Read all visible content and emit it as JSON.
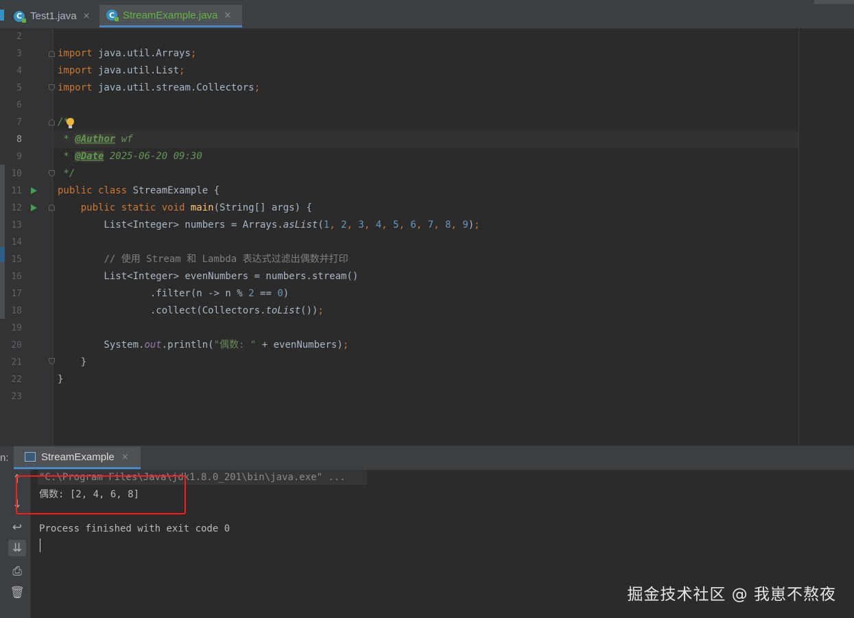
{
  "tabs": [
    {
      "label": "Test1.java",
      "close": "×",
      "color": "#a9b7c6",
      "active": false
    },
    {
      "label": "StreamExample.java",
      "close": "×",
      "color": "#62b543",
      "active": true
    }
  ],
  "editor": {
    "current_line": 8,
    "lines": [
      {
        "n": "2",
        "html": ""
      },
      {
        "n": "3",
        "html": "<span class=\"kw\">import</span> java.util.Arrays<span class=\"kw\">;</span>"
      },
      {
        "n": "4",
        "html": "<span class=\"kw\">import</span> java.util.List<span class=\"kw\">;</span>"
      },
      {
        "n": "5",
        "html": "<span class=\"kw\">import</span> java.util.stream.Collectors<span class=\"kw\">;</span>"
      },
      {
        "n": "6",
        "html": ""
      },
      {
        "n": "7",
        "html": "<span class=\"doc\">/**</span>"
      },
      {
        "n": "8",
        "html": "<span class=\"doc\"> * </span><span class=\"tag\">@Author</span><span class=\"doc\"> wf</span>"
      },
      {
        "n": "9",
        "html": "<span class=\"doc\"> * </span><span class=\"tag\">@Date</span><span class=\"doc\"> 2025-06-20 09:30</span>"
      },
      {
        "n": "10",
        "html": "<span class=\"doc\"> */</span>"
      },
      {
        "n": "11",
        "html": "<span class=\"kw\">public class</span> StreamExample {"
      },
      {
        "n": "12",
        "html": "    <span class=\"kw\">public static void</span> <span class=\"fn\">main</span>(String[] args) {"
      },
      {
        "n": "13",
        "html": "        List&lt;Integer&gt; numbers = Arrays.<span class=\"it\">asList</span>(<span class=\"num\">1</span><span class=\"kw\">,</span> <span class=\"num\">2</span><span class=\"kw\">,</span> <span class=\"num\">3</span><span class=\"kw\">,</span> <span class=\"num\">4</span><span class=\"kw\">,</span> <span class=\"num\">5</span><span class=\"kw\">,</span> <span class=\"num\">6</span><span class=\"kw\">,</span> <span class=\"num\">7</span><span class=\"kw\">,</span> <span class=\"num\">8</span><span class=\"kw\">,</span> <span class=\"num\">9</span>)<span class=\"kw\">;</span>"
      },
      {
        "n": "14",
        "html": ""
      },
      {
        "n": "15",
        "html": "        <span class=\"cm\">// 使用 Stream 和 Lambda 表达式过滤出偶数并打印</span>"
      },
      {
        "n": "16",
        "html": "        List&lt;Integer&gt; evenNumbers = numbers.stream()"
      },
      {
        "n": "17",
        "html": "                .filter(n -&gt; n % <span class=\"num\">2</span> == <span class=\"num\">0</span>)"
      },
      {
        "n": "18",
        "html": "                .collect(Collectors.<span class=\"it\">toList</span>())<span class=\"kw\">;</span>"
      },
      {
        "n": "19",
        "html": ""
      },
      {
        "n": "20",
        "html": "        System.<span class=\"fld\">out</span>.println(<span class=\"str\">\"偶数: \"</span> + evenNumbers)<span class=\"kw\">;</span>"
      },
      {
        "n": "21",
        "html": "    }"
      },
      {
        "n": "22",
        "html": "}"
      },
      {
        "n": "23",
        "html": ""
      }
    ]
  },
  "run_panel": {
    "label": "n:",
    "tab_label": "StreamExample",
    "tab_close": "×",
    "console_lines": [
      "\"C:\\Program Files\\Java\\jdk1.8.0_201\\bin\\java.exe\" ...",
      "偶数: [2, 4, 6, 8]",
      "",
      "Process finished with exit code 0"
    ],
    "side_icons": [
      "up-arrow-icon",
      "down-arrow-icon",
      "soft-wrap-icon",
      "scroll-to-end-icon",
      "print-icon",
      "trash-icon"
    ]
  },
  "watermark": "掘金技术社区 @ 我崽不熬夜",
  "colors": {
    "red_box": "#ff1a1a",
    "accent": "#4a88c7",
    "run_green": "#499c54"
  }
}
